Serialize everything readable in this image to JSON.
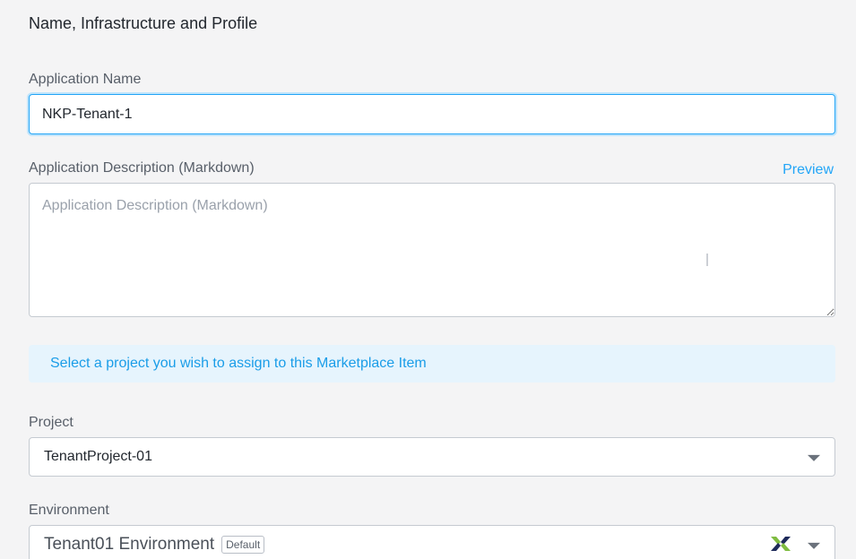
{
  "section": {
    "title": "Name, Infrastructure and Profile"
  },
  "app_name": {
    "label": "Application Name",
    "value": "NKP-Tenant-1"
  },
  "description": {
    "label": "Application Description (Markdown)",
    "placeholder": "Application Description (Markdown)",
    "preview_label": "Preview"
  },
  "banner": {
    "text": "Select a project you wish to assign to this Marketplace Item"
  },
  "project": {
    "label": "Project",
    "value": "TenantProject-01"
  },
  "environment": {
    "label": "Environment",
    "value": "Tenant01 Environment",
    "badge": "Default",
    "provider_icon": "nutanix-icon"
  },
  "colors": {
    "accent": "#22a5f7",
    "banner_bg": "#e6f4fd",
    "nutanix_green": "#7fbc41",
    "nutanix_blue": "#1e2a5a"
  }
}
